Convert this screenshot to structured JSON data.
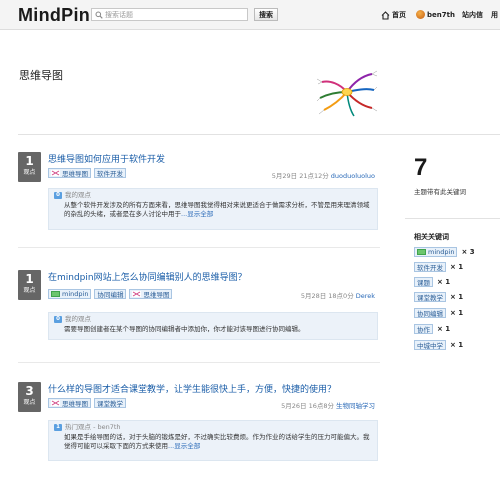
{
  "header": {
    "logo": "MindPin",
    "search_placeholder": "搜索话题",
    "search_button": "搜索",
    "nav_home": "首页",
    "nav_user": "ben7th",
    "nav_messages": "站内信",
    "nav_more": "用"
  },
  "page": {
    "title": "思维导图"
  },
  "questions": [
    {
      "votes": "1",
      "votes_label": "观点",
      "title": "思维导图如何应用于软件开发",
      "tags": [
        "思维导图",
        "软件开发"
      ],
      "date": "5月29日 21点12分",
      "user": "duoduoluoluo",
      "answer_badge": "0",
      "answer_head": "我的观点",
      "answer_text": "从整个软件开发涉及的所有方面来看，思维导图我觉得相对来说更适合于做需求分析，不管是用来理清领域的杂乱的头绪，或者是在多人讨论中用于",
      "answer_more": "...显示全部"
    },
    {
      "votes": "1",
      "votes_label": "观点",
      "title": "在mindpin网站上怎么协同编辑别人的思维导图？",
      "tags": [
        "mindpin",
        "协同编辑",
        "思维导图"
      ],
      "date": "5月28日 18点0分",
      "user": "Derek",
      "answer_badge": "0",
      "answer_head": "我的观点",
      "answer_text": "需要导图创建者在某个导图的协同编辑者中添加你，你才能对该导图进行协同编辑。",
      "answer_more": ""
    },
    {
      "votes": "3",
      "votes_label": "观点",
      "title": "什么样的导图才适合课堂教学，让学生能很快上手，方便，快捷的使用？",
      "tags": [
        "思维导图",
        "课堂教学"
      ],
      "date": "5月26日 16点8分",
      "user": "生物同轴学习",
      "answer_badge": "1",
      "answer_head": "热门观点 - ben7th",
      "answer_text": "如果是手绘导图的话，对于头脑的锻炼是好，不过确实比较费烦。作为作业的话给学生的压力可能偏大。我觉得可能可以采取下面的方式来使用",
      "answer_more": "...显示全部"
    }
  ],
  "sidebar": {
    "count": "7",
    "count_label": "主题带有此关键词",
    "keywords_title": "相关关键词",
    "keywords": [
      {
        "name": "mindpin",
        "count": "× 3",
        "logo": true
      },
      {
        "name": "软件开发",
        "count": "× 1",
        "logo": false
      },
      {
        "name": "课题",
        "count": "× 1",
        "logo": false
      },
      {
        "name": "课堂教学",
        "count": "× 1",
        "logo": false
      },
      {
        "name": "协同编辑",
        "count": "× 1",
        "logo": false
      },
      {
        "name": "协作",
        "count": "× 1",
        "logo": false
      },
      {
        "name": "中城中学",
        "count": "× 1",
        "logo": false
      }
    ]
  }
}
